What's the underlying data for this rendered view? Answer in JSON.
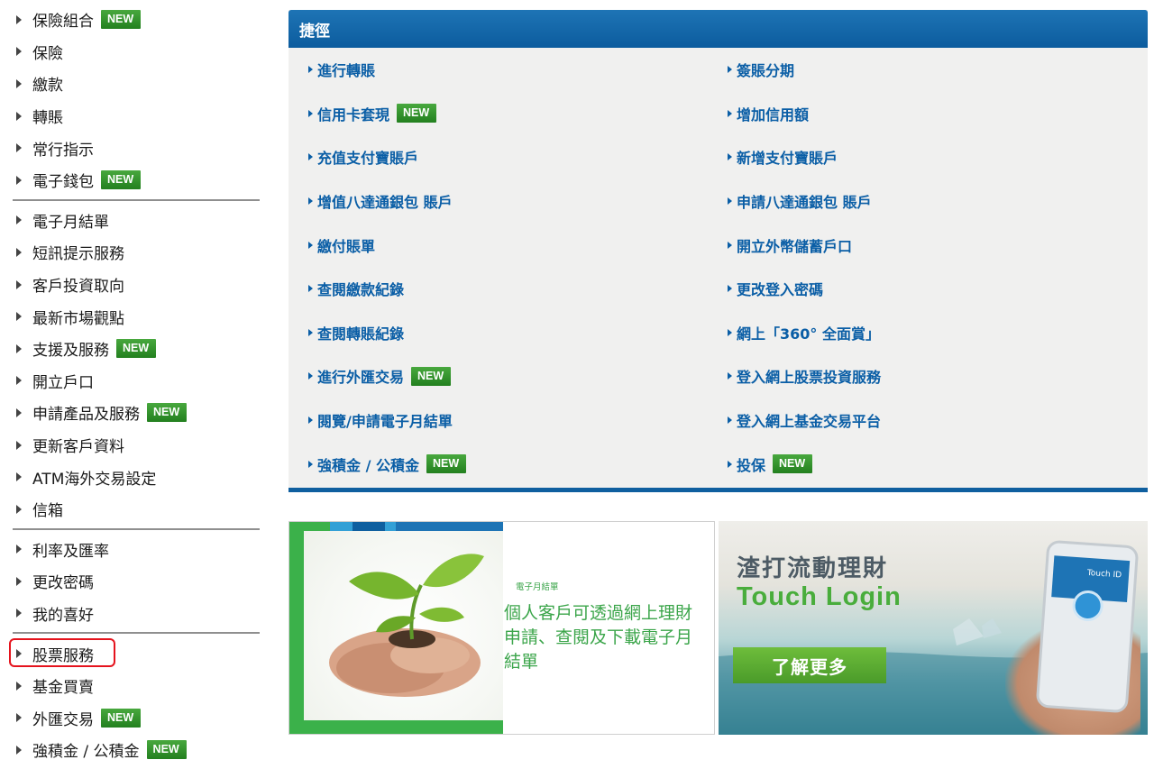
{
  "sidebar": {
    "new_label": "NEW",
    "items": [
      {
        "label": "保險組合",
        "new": true
      },
      {
        "label": "保險",
        "new": false
      },
      {
        "label": "繳款",
        "new": false
      },
      {
        "label": "轉賬",
        "new": false
      },
      {
        "label": "常行指示",
        "new": false
      },
      {
        "label": "電子錢包",
        "new": true
      },
      {
        "label": "電子月結單",
        "new": false
      },
      {
        "label": "短訊提示服務",
        "new": false
      },
      {
        "label": "客戶投資取向",
        "new": false
      },
      {
        "label": "最新市場觀點",
        "new": false
      },
      {
        "label": "支援及服務",
        "new": true
      },
      {
        "label": "開立戶口",
        "new": false
      },
      {
        "label": "申請產品及服務",
        "new": true
      },
      {
        "label": "更新客戶資料",
        "new": false
      },
      {
        "label": "ATM海外交易設定",
        "new": false
      },
      {
        "label": "信箱",
        "new": false
      },
      {
        "label": "利率及匯率",
        "new": false
      },
      {
        "label": "更改密碼",
        "new": false
      },
      {
        "label": "我的喜好",
        "new": false
      },
      {
        "label": "股票服務",
        "new": false
      },
      {
        "label": "基金買賣",
        "new": false
      },
      {
        "label": "外匯交易",
        "new": true
      },
      {
        "label": "強積金 / 公積金",
        "new": true
      }
    ]
  },
  "shortcuts": {
    "title": "捷徑",
    "items": [
      {
        "label": "進行轉賬",
        "new": false
      },
      {
        "label": "簽賬分期",
        "new": false
      },
      {
        "label": "信用卡套現",
        "new": true
      },
      {
        "label": "增加信用額",
        "new": false
      },
      {
        "label": "充值支付寶賬戶",
        "new": false
      },
      {
        "label": "新增支付寶賬戶",
        "new": false
      },
      {
        "label": "增值八達通銀包 賬戶",
        "new": false
      },
      {
        "label": "申請八達通銀包 賬戶",
        "new": false
      },
      {
        "label": "繳付賬單",
        "new": false
      },
      {
        "label": "開立外幣儲蓄戶口",
        "new": false
      },
      {
        "label": "查閱繳款紀錄",
        "new": false
      },
      {
        "label": "更改登入密碼",
        "new": false
      },
      {
        "label": "查閱轉賬紀錄",
        "new": false
      },
      {
        "label": "網上「360° 全面賞」",
        "new": false
      },
      {
        "label": "進行外匯交易",
        "new": true
      },
      {
        "label": "登入網上股票投資服務",
        "new": false
      },
      {
        "label": "閱覽/申請電子月結單",
        "new": false
      },
      {
        "label": "登入網上基金交易平台",
        "new": false
      },
      {
        "label": "強積金 / 公積金",
        "new": true
      },
      {
        "label": "投保",
        "new": true
      }
    ]
  },
  "banner_estatement": {
    "small_label": "電子月結單",
    "text": "個人客戶可透過網上理財申請、查閱及下載電子月結單"
  },
  "banner_touch": {
    "title": "渣打流動理財",
    "subtitle": "Touch Login",
    "button": "了解更多",
    "phone_text": "Touch ID"
  },
  "colors": {
    "header_blue": "#0c5c9e",
    "link_blue": "#0a5ea6",
    "new_green": "#2f8f2e",
    "highlight_red": "#e5131d"
  }
}
